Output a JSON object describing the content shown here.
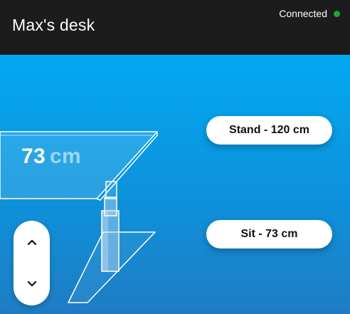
{
  "header": {
    "title": "Max's desk",
    "status": "Connected",
    "status_color": "#1aa831"
  },
  "desk": {
    "height_value": "73",
    "height_unit": "cm"
  },
  "presets": {
    "stand_label": "Stand - 120 cm",
    "sit_label": "Sit - 73 cm"
  },
  "controls": {
    "up_icon": "chevron-up-icon",
    "down_icon": "chevron-down-icon"
  },
  "colors": {
    "header_bg": "#1c1c1c",
    "accent_blue": "#01a6f0",
    "button_bg": "#ffffff"
  }
}
